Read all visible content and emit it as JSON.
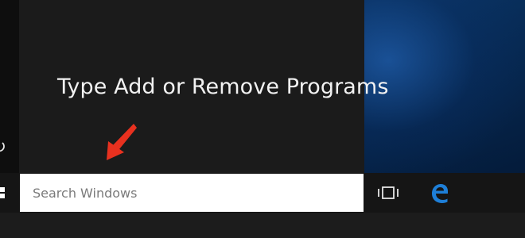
{
  "instruction": {
    "text": "Type Add or Remove Programs"
  },
  "search": {
    "placeholder": "Search Windows",
    "value": ""
  },
  "colors": {
    "start_panel": "#1b1b1b",
    "taskbar": "#151515",
    "accent_arrow": "#e8311f",
    "edge_blue": "#1e7fd8",
    "desktop_blue": "#0b3566"
  },
  "icons": [
    "power-icon",
    "windows-logo-icon",
    "task-view-icon",
    "edge-icon",
    "red-arrow-icon"
  ]
}
